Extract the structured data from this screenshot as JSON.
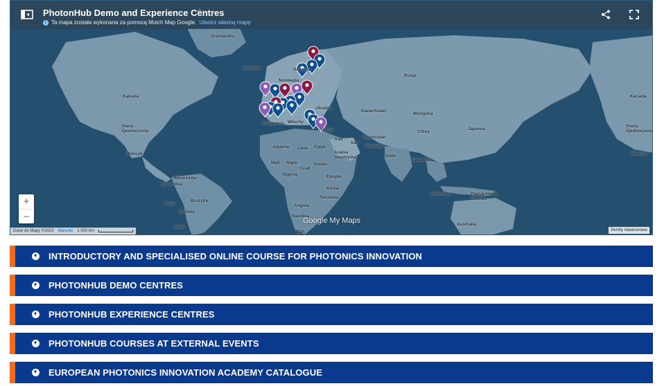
{
  "map": {
    "title": "PhotonHub Demo and Experience Centres",
    "info_text": "Ta mapa została wykonana za pomocą Moich Map Google.",
    "info_link": "Utwórz własną mapę",
    "attribution": "Dane do Mapy ©2023",
    "terms_link": "Warunki",
    "scale_label": "1 000 km",
    "shortcuts_label": "Skróty klawiszowe",
    "google_logo": "Google",
    "mymaps_label": "My Maps",
    "zoom_in": "+",
    "zoom_out": "−",
    "labels": [
      {
        "text": "Grenlandia"
      },
      {
        "text": "Islandia"
      },
      {
        "text": "Szwecja"
      },
      {
        "text": "Norwegia"
      },
      {
        "text": "Rosja"
      },
      {
        "text": "Kanada"
      },
      {
        "text": "Kanada"
      },
      {
        "text": "Stany Zjednoczone"
      },
      {
        "text": "Stany Zjednoczone"
      },
      {
        "text": "Meksyk"
      },
      {
        "text": "Meksyk"
      },
      {
        "text": "Ukraina"
      },
      {
        "text": "Hiszpania"
      },
      {
        "text": "Włochy"
      },
      {
        "text": "Turcja"
      },
      {
        "text": "Kazachstan"
      },
      {
        "text": "Mongolia"
      },
      {
        "text": "Chiny"
      },
      {
        "text": "Japonia"
      },
      {
        "text": "Irak"
      },
      {
        "text": "Iran"
      },
      {
        "text": "Afganistan"
      },
      {
        "text": "Pakistan"
      },
      {
        "text": "Indie"
      },
      {
        "text": "Tajlandia"
      },
      {
        "text": "Algieria"
      },
      {
        "text": "Libia"
      },
      {
        "text": "Egipt"
      },
      {
        "text": "Arabia Saudyjska"
      },
      {
        "text": "Mali"
      },
      {
        "text": "Niger"
      },
      {
        "text": "Czad"
      },
      {
        "text": "Sudan"
      },
      {
        "text": "Nigeria"
      },
      {
        "text": "Etiopia"
      },
      {
        "text": "Kenia"
      },
      {
        "text": "Tanzania"
      },
      {
        "text": "Angola"
      },
      {
        "text": "Namibia"
      },
      {
        "text": "RPA"
      },
      {
        "text": "Wenezuela"
      },
      {
        "text": "Kolumbia"
      },
      {
        "text": "Peru"
      },
      {
        "text": "Brazylia"
      },
      {
        "text": "Boliwia"
      },
      {
        "text": "Chile"
      },
      {
        "text": "Indonezja"
      },
      {
        "text": "Papua-Nowa Gwinea"
      },
      {
        "text": "Australia"
      }
    ]
  },
  "accordion": [
    {
      "label": "INTRODUCTORY AND SPECIALISED ONLINE COURSE FOR PHOTONICS INNOVATION"
    },
    {
      "label": "PHOTONHUB DEMO CENTRES"
    },
    {
      "label": "PHOTONHUB EXPERIENCE CENTRES"
    },
    {
      "label": "PHOTONHUB COURSES AT EXTERNAL EVENTS"
    },
    {
      "label": "EUROPEAN PHOTONICS INNOVATION ACADEMY CATALOGUE"
    }
  ],
  "colors": {
    "accordion_bg": "#0a3a8e",
    "accordion_accent": "#f26a1b",
    "pin_blue": "#0d4f8f",
    "pin_maroon": "#8a1a43",
    "pin_purple": "#8b5bb8"
  },
  "icons": {
    "menu": "sidebar-toggle-icon",
    "share": "share-icon",
    "fullscreen": "fullscreen-icon",
    "accordion": "arrow-circle-down-icon",
    "pin": "map-pin-icon"
  }
}
